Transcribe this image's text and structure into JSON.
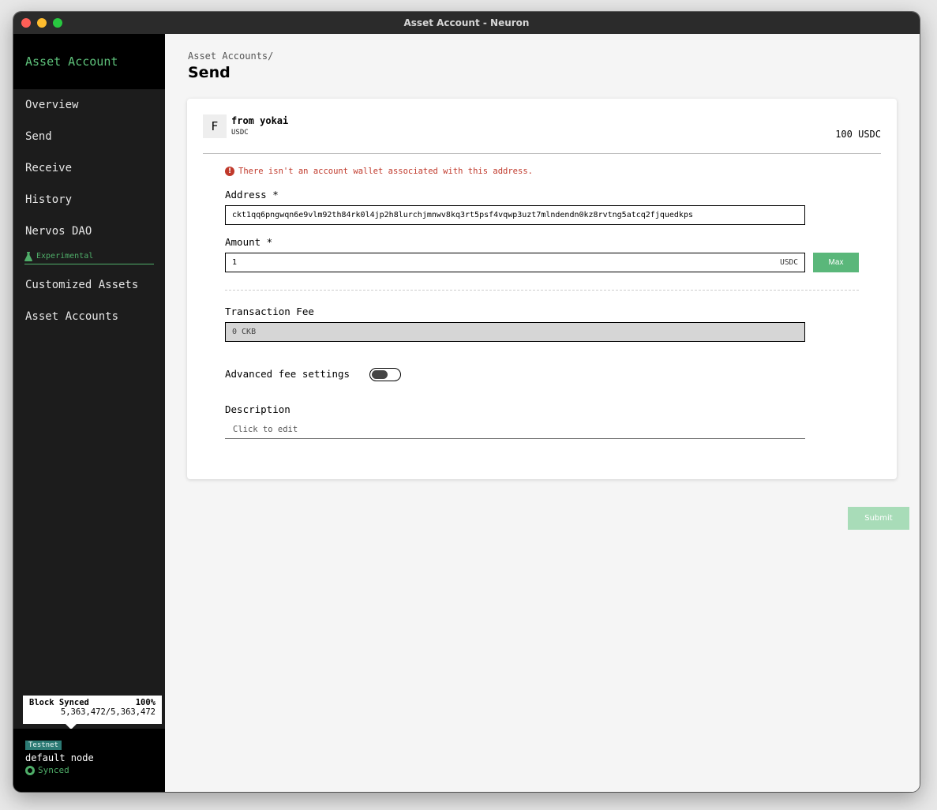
{
  "window": {
    "title": "Asset Account - Neuron"
  },
  "sidebar": {
    "header": "Asset Account",
    "items": [
      {
        "label": "Overview"
      },
      {
        "label": "Send"
      },
      {
        "label": "Receive"
      },
      {
        "label": "History"
      },
      {
        "label": "Nervos DAO"
      }
    ],
    "experimental_label": "Experimental",
    "experimental_items": [
      {
        "label": "Customized Assets"
      },
      {
        "label": "Asset Accounts"
      }
    ],
    "sync": {
      "title": "Block Synced",
      "percent": "100%",
      "blocks": "5,363,472/5,363,472"
    },
    "network": {
      "badge": "Testnet",
      "node": "default node",
      "status": "Synced"
    }
  },
  "main": {
    "breadcrumb": "Asset Accounts/",
    "title": "Send",
    "account": {
      "avatar_letter": "F",
      "name": "from yokai",
      "token": "USDC",
      "balance": "100 USDC"
    },
    "error": "There isn't an account wallet associated with this address.",
    "address": {
      "label": "Address *",
      "value": "ckt1qq6pngwqn6e9vlm92th84rk0l4jp2h8lurchjmnwv8kq3rt5psf4vqwp3uzt7mlndendn0kz8rvtng5atcq2fjquedkps"
    },
    "amount": {
      "label": "Amount *",
      "value": "1",
      "unit": "USDC",
      "max_label": "Max"
    },
    "fee": {
      "label": "Transaction Fee",
      "value": "0 CKB"
    },
    "advanced_label": "Advanced fee settings",
    "description": {
      "label": "Description",
      "placeholder": "Click to edit"
    },
    "submit_label": "Submit"
  },
  "colors": {
    "accent": "#5ab77a",
    "sidebar_bg": "#1c1c1c",
    "error": "#c0392b",
    "testnet_badge": "#2c7a74"
  }
}
